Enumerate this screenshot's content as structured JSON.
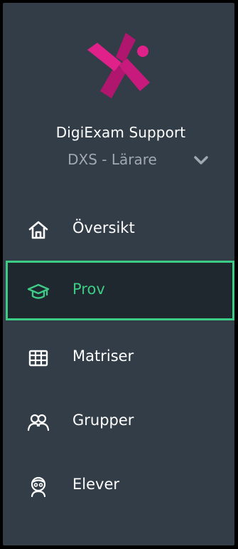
{
  "sidebar": {
    "org_name": "DigiExam Support",
    "role": "DXS - Lärare",
    "items": [
      {
        "label": "Översikt",
        "icon": "home-icon",
        "active": false
      },
      {
        "label": "Prov",
        "icon": "graduation-cap-icon",
        "active": true
      },
      {
        "label": "Matriser",
        "icon": "grid-table-icon",
        "active": false
      },
      {
        "label": "Grupper",
        "icon": "group-users-icon",
        "active": false
      },
      {
        "label": "Elever",
        "icon": "student-icon",
        "active": false
      }
    ]
  },
  "colors": {
    "sidebar_bg": "#323d47",
    "accent": "#3ecb86",
    "logo_pink": "#e0218a",
    "logo_magenta": "#b0166e",
    "active_bg": "#1f272f"
  }
}
